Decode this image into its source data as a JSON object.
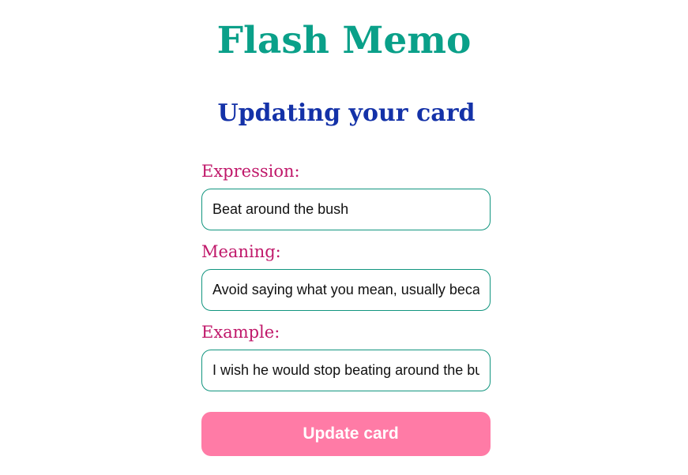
{
  "app": {
    "title": "Flash Memo"
  },
  "page": {
    "heading": "Updating your card"
  },
  "form": {
    "fields": [
      {
        "label": "Expression:",
        "value": "Beat around the bush"
      },
      {
        "label": "Meaning:",
        "value": "Avoid saying what you mean, usually becaus"
      },
      {
        "label": "Example:",
        "value": "I wish he would stop beating around the bush"
      }
    ],
    "submit_label": "Update card"
  },
  "colors": {
    "title": "#0aa089",
    "heading": "#1432a8",
    "label": "#c0186a",
    "input_border": "#11957f",
    "button_bg": "#ff7ba6",
    "button_text": "#ffffff"
  }
}
